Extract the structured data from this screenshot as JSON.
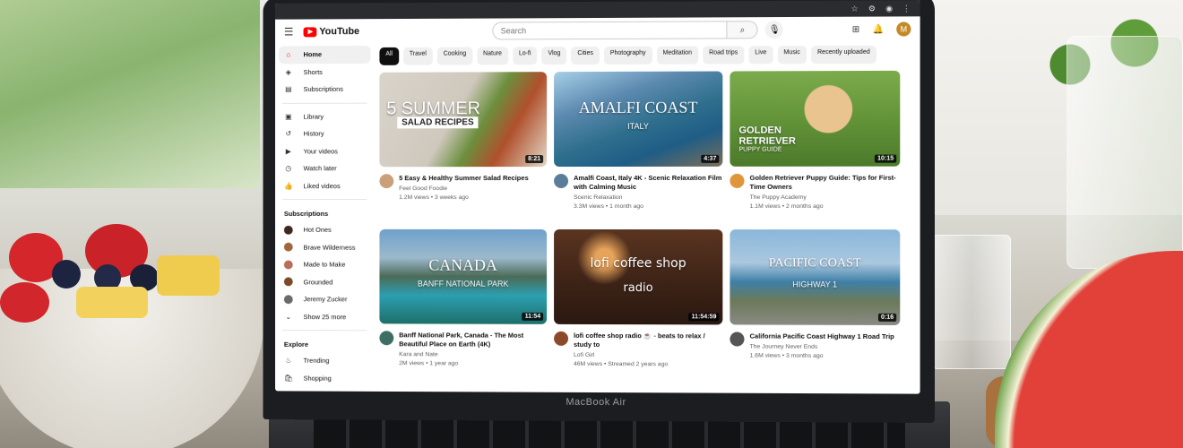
{
  "device": {
    "brand": "MacBook Air"
  },
  "header": {
    "logo": "YouTube",
    "search_placeholder": "Search",
    "avatar_letter": "M"
  },
  "sidebar": {
    "main": [
      {
        "label": "Home",
        "icon": "home-icon",
        "glyph": "⌂"
      },
      {
        "label": "Shorts",
        "icon": "shorts-icon",
        "glyph": "◈"
      },
      {
        "label": "Subscriptions",
        "icon": "subscriptions-icon",
        "glyph": "▤"
      }
    ],
    "library": [
      {
        "label": "Library",
        "icon": "library-icon",
        "glyph": "▣"
      },
      {
        "label": "History",
        "icon": "history-icon",
        "glyph": "↺"
      },
      {
        "label": "Your videos",
        "icon": "your-videos-icon",
        "glyph": "▶"
      },
      {
        "label": "Watch later",
        "icon": "watch-later-icon",
        "glyph": "◷"
      },
      {
        "label": "Liked videos",
        "icon": "liked-videos-icon",
        "glyph": "👍"
      }
    ],
    "subscriptions_heading": "Subscriptions",
    "subscriptions": [
      {
        "label": "Hot Ones",
        "color": "#3a2a20"
      },
      {
        "label": "Brave Wilderness",
        "color": "#a0683a"
      },
      {
        "label": "Made to Make",
        "color": "#b86e58"
      },
      {
        "label": "Grounded",
        "color": "#7a4a2a"
      },
      {
        "label": "Jeremy Zucker",
        "color": "#6a6a6a"
      }
    ],
    "show_more": "Show 25 more",
    "explore_heading": "Explore",
    "explore": [
      {
        "label": "Trending",
        "icon": "trending-icon",
        "glyph": "♨"
      },
      {
        "label": "Shopping",
        "icon": "shopping-icon",
        "glyph": "🛍"
      }
    ]
  },
  "chips": [
    "All",
    "Travel",
    "Cooking",
    "Nature",
    "Lo-fi",
    "Vlog",
    "Cities",
    "Photography",
    "Meditation",
    "Road trips",
    "Live",
    "Music",
    "Recently uploaded"
  ],
  "videos": [
    {
      "title": "5 Easy & Healthy Summer Salad Recipes",
      "channel": "Feel Good Foodie",
      "stats": "1.2M views • 3 weeks ago",
      "duration": "8:21",
      "overlay1": "5 SUMMER",
      "overlay2": "SALAD RECIPES",
      "bg": "linear-gradient(120deg,#d9d4cb 0%,#cfc8bd 45%,#6c8f3d 60%,#b0502c 75%,#e2d9c8 100%)",
      "avatar": "#c9a07a"
    },
    {
      "title": "Amalfi Coast, Italy 4K - Scenic Relaxation Film with Calming Music",
      "channel": "Scenic Relaxation",
      "stats": "3.3M views • 1 month ago",
      "duration": "4:37",
      "overlay1": "AMALFI COAST",
      "overlay2": "ITALY",
      "bg": "linear-gradient(160deg,#a7cfe8 0%,#5d8ab0 30%,#2f6f8d 55%,#1f5d86 75%,#7c6e5a 100%)",
      "avatar": "#5b7d9a"
    },
    {
      "title": "Golden Retriever Puppy Guide: Tips for First-Time Owners",
      "channel": "The Puppy Academy",
      "stats": "1.1M views • 2 months ago",
      "duration": "10:15",
      "overlay1": "GOLDEN RETRIEVER",
      "overlay2": "PUPPY GUIDE",
      "bg": "radial-gradient(circle at 58% 40%,#e9c48e 0 26px,transparent 27px),linear-gradient(180deg,#7bab4b 0%,#5e8f35 60%,#4b7a2b 100%)",
      "avatar": "#e0953a"
    },
    {
      "title": "Banff National Park, Canada - The Most Beautiful Place on Earth (4K)",
      "channel": "Kara and Nate",
      "stats": "2M views • 1 year ago",
      "duration": "11:54",
      "overlay1": "CANADA",
      "overlay2": "BANFF NATIONAL PARK",
      "bg": "linear-gradient(180deg,#6fa1cc 0%,#9cb9cc 30%,#4b6b58 50%,#2c9fb0 70%,#1d6f6a 100%)",
      "avatar": "#3c6e63"
    },
    {
      "title": "lofi coffee shop radio ☕ - beats to relax / study to",
      "channel": "Lofi Girl",
      "stats": "46M views • Streamed 2 years ago",
      "duration": "11:54:59",
      "overlay1": "lofi coffee shop",
      "overlay2": "radio",
      "bg": "radial-gradient(circle at 30% 30%,#e6a35a 0 10px,transparent 30px),linear-gradient(180deg,#5a3420 0%,#3b2216 60%,#2a1810 100%)",
      "avatar": "#8a4a2a"
    },
    {
      "title": "California Pacific Coast Highway 1 Road Trip",
      "channel": "The Journey Never Ends",
      "stats": "1.6M views • 3 months ago",
      "duration": "0:16",
      "overlay1": "PACIFIC COAST",
      "overlay2": "HIGHWAY 1",
      "bg": "linear-gradient(180deg,#8ab7db 0%,#aac8df 35%,#3f7fa6 55%,#6b7a5a 75%,#8a8a84 100%)",
      "avatar": "#555555"
    }
  ]
}
